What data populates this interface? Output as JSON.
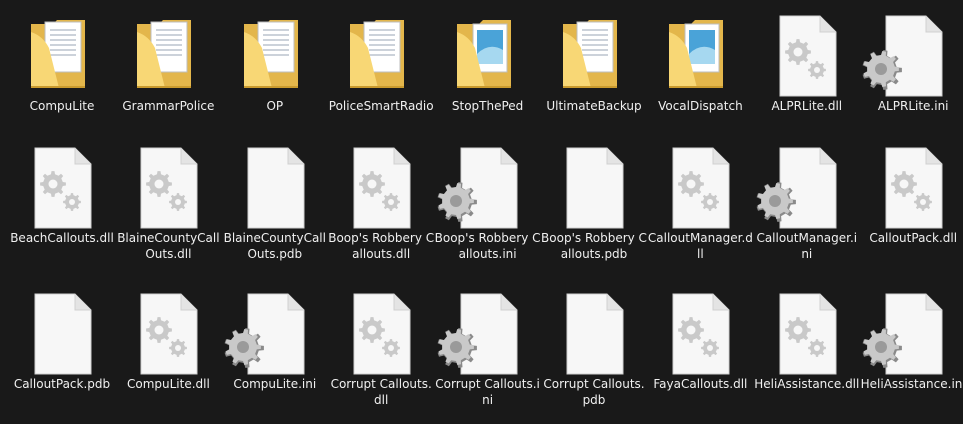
{
  "items": [
    {
      "name": "CompuLite",
      "type": "folder",
      "preview": "doc"
    },
    {
      "name": "GrammarPolice",
      "type": "folder",
      "preview": "doc"
    },
    {
      "name": "OP",
      "type": "folder",
      "preview": "doc"
    },
    {
      "name": "PoliceSmartRadio",
      "type": "folder",
      "preview": "doc"
    },
    {
      "name": "StopThePed",
      "type": "folder",
      "preview": "image"
    },
    {
      "name": "UltimateBackup",
      "type": "folder",
      "preview": "doc"
    },
    {
      "name": "VocalDispatch",
      "type": "folder",
      "preview": "image"
    },
    {
      "name": "ALPRLite.dll",
      "type": "dll"
    },
    {
      "name": "ALPRLite.ini",
      "type": "ini"
    },
    {
      "name": "BeachCallouts.dll",
      "type": "dll"
    },
    {
      "name": "BlaineCountyCallOuts.dll",
      "type": "dll"
    },
    {
      "name": "BlaineCountyCallOuts.pdb",
      "type": "pdb"
    },
    {
      "name": "Boop's Robbery Callouts.dll",
      "type": "dll"
    },
    {
      "name": "Boop's Robbery Callouts.ini",
      "type": "ini"
    },
    {
      "name": "Boop's Robbery Callouts.pdb",
      "type": "pdb"
    },
    {
      "name": "CalloutManager.dll",
      "type": "dll"
    },
    {
      "name": "CalloutManager.ini",
      "type": "ini"
    },
    {
      "name": "CalloutPack.dll",
      "type": "dll"
    },
    {
      "name": "CalloutPack.pdb",
      "type": "pdb"
    },
    {
      "name": "CompuLite.dll",
      "type": "dll"
    },
    {
      "name": "CompuLite.ini",
      "type": "ini"
    },
    {
      "name": "Corrupt Callouts.dll",
      "type": "dll"
    },
    {
      "name": "Corrupt Callouts.ini",
      "type": "ini"
    },
    {
      "name": "Corrupt Callouts.pdb",
      "type": "pdb"
    },
    {
      "name": "FayaCallouts.dll",
      "type": "dll"
    },
    {
      "name": "HeliAssistance.dll",
      "type": "dll"
    },
    {
      "name": "HeliAssistance.ini",
      "type": "ini"
    }
  ],
  "colors": {
    "background": "#191919",
    "text": "#f0f0f0",
    "folder_back": "#e3b64b",
    "folder_front": "#f8d775",
    "page": "#f7f7f7",
    "gear_light": "#c9c9c9",
    "gear_dark": "#8a8a8a"
  }
}
